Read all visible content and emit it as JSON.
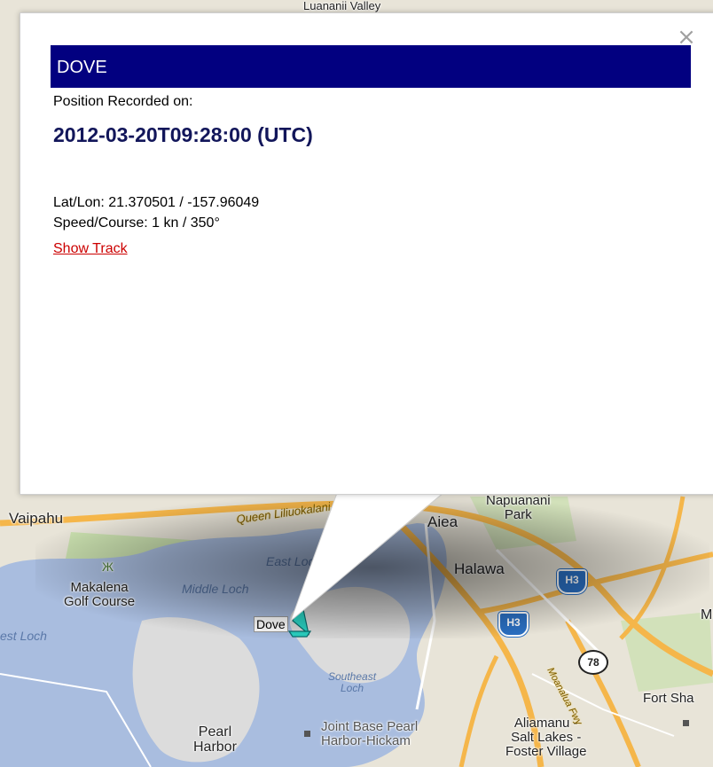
{
  "popup": {
    "title": "DOVE",
    "recorded_label": "Position Recorded on:",
    "recorded_value": "2012-03-20T09:28:00 (UTC)",
    "latlon": "Lat/Lon: 21.370501 / -157.96049",
    "speed_course": "Speed/Course: 1 kn / 350°",
    "show_track": "Show Track",
    "close_glyph": "×",
    "colors": {
      "title_bg": "#020080",
      "link": "#cc0000"
    }
  },
  "map": {
    "places": {
      "waipahu": "Vaipahu",
      "aiea": "Aiea",
      "napuanani": "Napuanani\nPark",
      "halawa": "Halawa",
      "makalena": "Makalena\nGolf Course",
      "middle_loch": "Middle Loch",
      "east_loch": "East Loc",
      "west_loch": "est Loch",
      "southeast_loch": "Southeast\nLoch",
      "pearl_harbor": "Pearl\nHarbor",
      "joint_base": "Joint Base Pearl\nHarbor-Hickam",
      "aliamanu": "Aliamanu -\nSalt Lakes -\nFoster Village",
      "fort_shafter": "Fort Sha",
      "m_label": "M",
      "top_valley": "Luananii Valley",
      "queen_road": "Queen Liliuokalani Fwy",
      "moanalua": "Moanalua Fwy"
    },
    "shields": {
      "h3_a": "H3",
      "h3_b": "H3",
      "route78": "78"
    },
    "vessel": {
      "name": "Dove",
      "icon": "sailboat-icon"
    },
    "colors": {
      "water": "#a9bddf",
      "land": "#e8e4d8",
      "highway": "#f5b64a",
      "park": "#c9dfae"
    }
  }
}
